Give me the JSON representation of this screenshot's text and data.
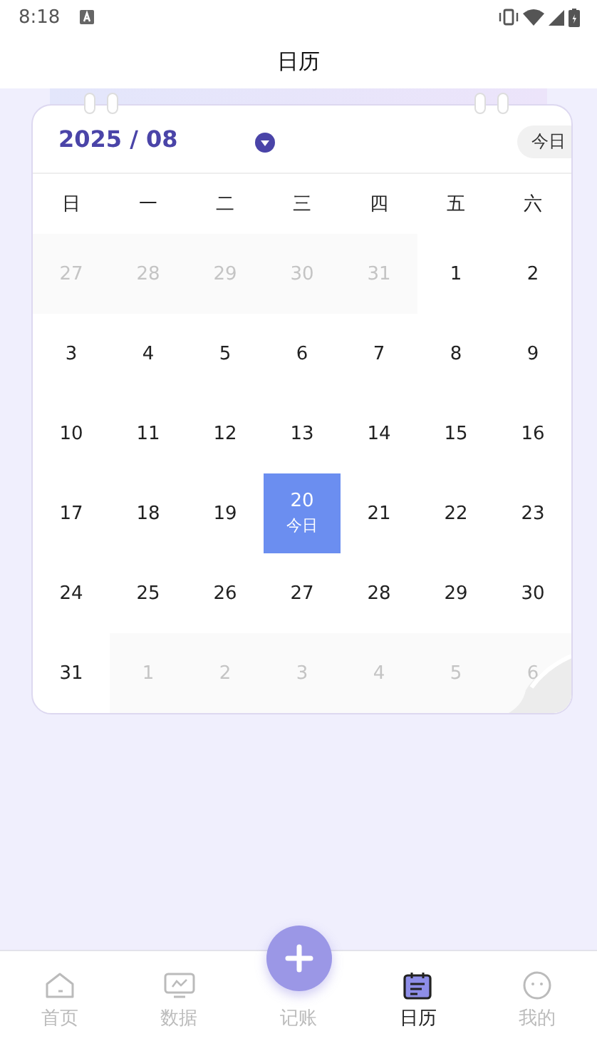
{
  "status_bar": {
    "time": "8:18"
  },
  "title": "日历",
  "calendar": {
    "month": "2025 / 08",
    "today_button": "今日",
    "weekdays": [
      "日",
      "一",
      "二",
      "三",
      "四",
      "五",
      "六"
    ],
    "days": [
      {
        "day": "27",
        "outside": true,
        "selected": false
      },
      {
        "day": "28",
        "outside": true,
        "selected": false
      },
      {
        "day": "29",
        "outside": true,
        "selected": false
      },
      {
        "day": "30",
        "outside": true,
        "selected": false
      },
      {
        "day": "31",
        "outside": true,
        "selected": false
      },
      {
        "day": "1",
        "outside": false,
        "selected": false
      },
      {
        "day": "2",
        "outside": false,
        "selected": false
      },
      {
        "day": "3",
        "outside": false,
        "selected": false
      },
      {
        "day": "4",
        "outside": false,
        "selected": false
      },
      {
        "day": "5",
        "outside": false,
        "selected": false
      },
      {
        "day": "6",
        "outside": false,
        "selected": false
      },
      {
        "day": "7",
        "outside": false,
        "selected": false
      },
      {
        "day": "8",
        "outside": false,
        "selected": false
      },
      {
        "day": "9",
        "outside": false,
        "selected": false
      },
      {
        "day": "10",
        "outside": false,
        "selected": false
      },
      {
        "day": "11",
        "outside": false,
        "selected": false
      },
      {
        "day": "12",
        "outside": false,
        "selected": false
      },
      {
        "day": "13",
        "outside": false,
        "selected": false
      },
      {
        "day": "14",
        "outside": false,
        "selected": false
      },
      {
        "day": "15",
        "outside": false,
        "selected": false
      },
      {
        "day": "16",
        "outside": false,
        "selected": false
      },
      {
        "day": "17",
        "outside": false,
        "selected": false
      },
      {
        "day": "18",
        "outside": false,
        "selected": false
      },
      {
        "day": "19",
        "outside": false,
        "selected": false
      },
      {
        "day": "20",
        "outside": false,
        "selected": true,
        "note": "今日"
      },
      {
        "day": "21",
        "outside": false,
        "selected": false
      },
      {
        "day": "22",
        "outside": false,
        "selected": false
      },
      {
        "day": "23",
        "outside": false,
        "selected": false
      },
      {
        "day": "24",
        "outside": false,
        "selected": false
      },
      {
        "day": "25",
        "outside": false,
        "selected": false
      },
      {
        "day": "26",
        "outside": false,
        "selected": false
      },
      {
        "day": "27",
        "outside": false,
        "selected": false
      },
      {
        "day": "28",
        "outside": false,
        "selected": false
      },
      {
        "day": "29",
        "outside": false,
        "selected": false
      },
      {
        "day": "30",
        "outside": false,
        "selected": false
      },
      {
        "day": "31",
        "outside": false,
        "selected": false
      },
      {
        "day": "1",
        "outside": true,
        "selected": false
      },
      {
        "day": "2",
        "outside": true,
        "selected": false
      },
      {
        "day": "3",
        "outside": true,
        "selected": false
      },
      {
        "day": "4",
        "outside": true,
        "selected": false
      },
      {
        "day": "5",
        "outside": true,
        "selected": false
      },
      {
        "day": "6",
        "outside": true,
        "selected": false
      }
    ]
  },
  "nav": [
    {
      "label": "首页",
      "kind": "home",
      "selected": false
    },
    {
      "label": "数据",
      "kind": "chart",
      "selected": false
    },
    {
      "label": "记账",
      "kind": "add",
      "selected": false
    },
    {
      "label": "日历",
      "kind": "calendar",
      "selected": true
    },
    {
      "label": "我的",
      "kind": "face",
      "selected": false
    }
  ]
}
